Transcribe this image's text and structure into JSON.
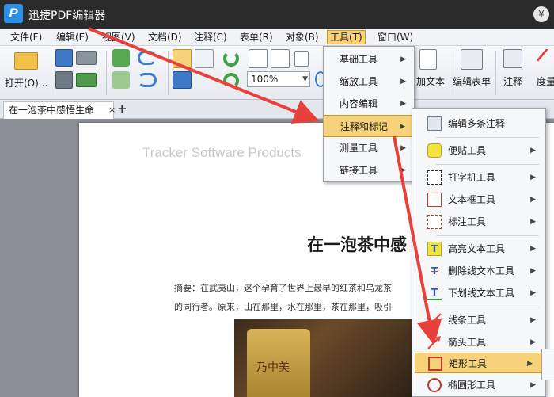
{
  "app": {
    "title": "迅捷PDF编辑器",
    "logo_letter": "P",
    "yen_button": "¥"
  },
  "menubar": {
    "items": [
      "文件(F)",
      "编辑(E)",
      "视图(V)",
      "文档(D)",
      "注释(C)",
      "表单(R)",
      "对象(B)",
      "工具(T)",
      "窗口(W)"
    ]
  },
  "ribbon": {
    "open_label": "打开(O)...",
    "zoom_value": "100%",
    "add_text_label": "加文本",
    "edit_form_label": "编辑表单",
    "annotate_label": "注释",
    "measure_label": "度量"
  },
  "tab": {
    "title": "在一泡茶中感悟生命",
    "close": "×",
    "add": "+"
  },
  "document": {
    "watermark": "Tracker Software Products",
    "heading": "在一泡茶中感",
    "abstract_line1": "摘要：在武夷山，这个孕育了世界上最早的红茶和乌龙茶",
    "abstract_line2": "的同行者。原来，山在那里，水在那里，茶在那里，吸引",
    "photo_label": "乃中美"
  },
  "tools_menu": {
    "items": [
      "基础工具",
      "缩放工具",
      "内容编辑",
      "注释和标记",
      "测量工具",
      "链接工具"
    ],
    "highlighted": "注释和标记"
  },
  "annot_submenu": {
    "items": [
      {
        "label": "编辑多条注释",
        "icon": "edit-annotations-icon",
        "has_sub": false
      },
      {
        "label": "便贴工具",
        "icon": "sticky-note-icon",
        "has_sub": true
      },
      {
        "label": "打字机工具",
        "icon": "typewriter-icon",
        "has_sub": true
      },
      {
        "label": "文本框工具",
        "icon": "textbox-icon",
        "has_sub": true
      },
      {
        "label": "标注工具",
        "icon": "callout-icon",
        "has_sub": true
      },
      {
        "label": "高亮文本工具",
        "icon": "highlight-icon",
        "has_sub": true
      },
      {
        "label": "删除线文本工具",
        "icon": "strikeout-icon",
        "has_sub": true
      },
      {
        "label": "下划线文本工具",
        "icon": "underline-icon",
        "has_sub": true
      },
      {
        "label": "线条工具",
        "icon": "line-icon",
        "has_sub": true
      },
      {
        "label": "箭头工具",
        "icon": "arrow-icon",
        "has_sub": true
      },
      {
        "label": "矩形工具",
        "icon": "rectangle-icon",
        "has_sub": true
      },
      {
        "label": "椭圆形工具",
        "icon": "ellipse-icon",
        "has_sub": true
      }
    ],
    "highlighted": "矩形工具"
  },
  "colors": {
    "highlight": "#f6d27a",
    "annotation_arrow": "#e8403a",
    "titlebar": "#2b2b2b"
  }
}
